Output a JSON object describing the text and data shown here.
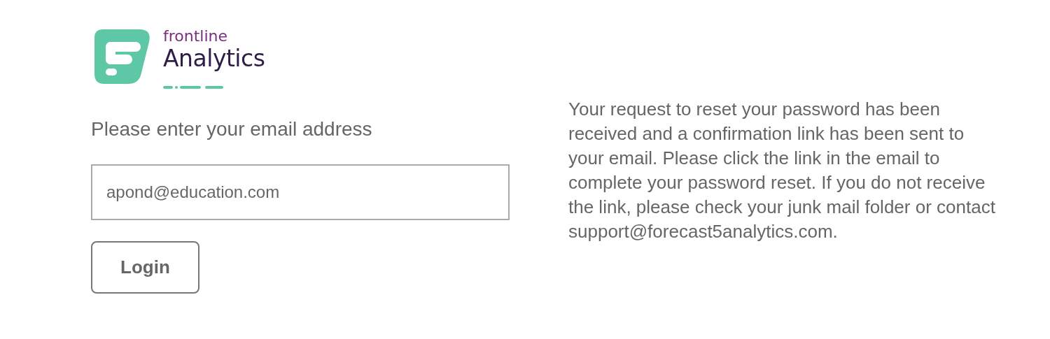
{
  "logo": {
    "line_1": "frontline",
    "line_2": "Analytics"
  },
  "form": {
    "label": "Please enter your email address",
    "email": {
      "value": "apond@education.com"
    },
    "button": "Login"
  },
  "message": "Your request to reset your password has been received and a confirmation link has been sent to your email. Please click the link in the email to complete your password reset. If you do not receive the link, please check your junk mail folder or contact support@forecast5analytics.com."
}
